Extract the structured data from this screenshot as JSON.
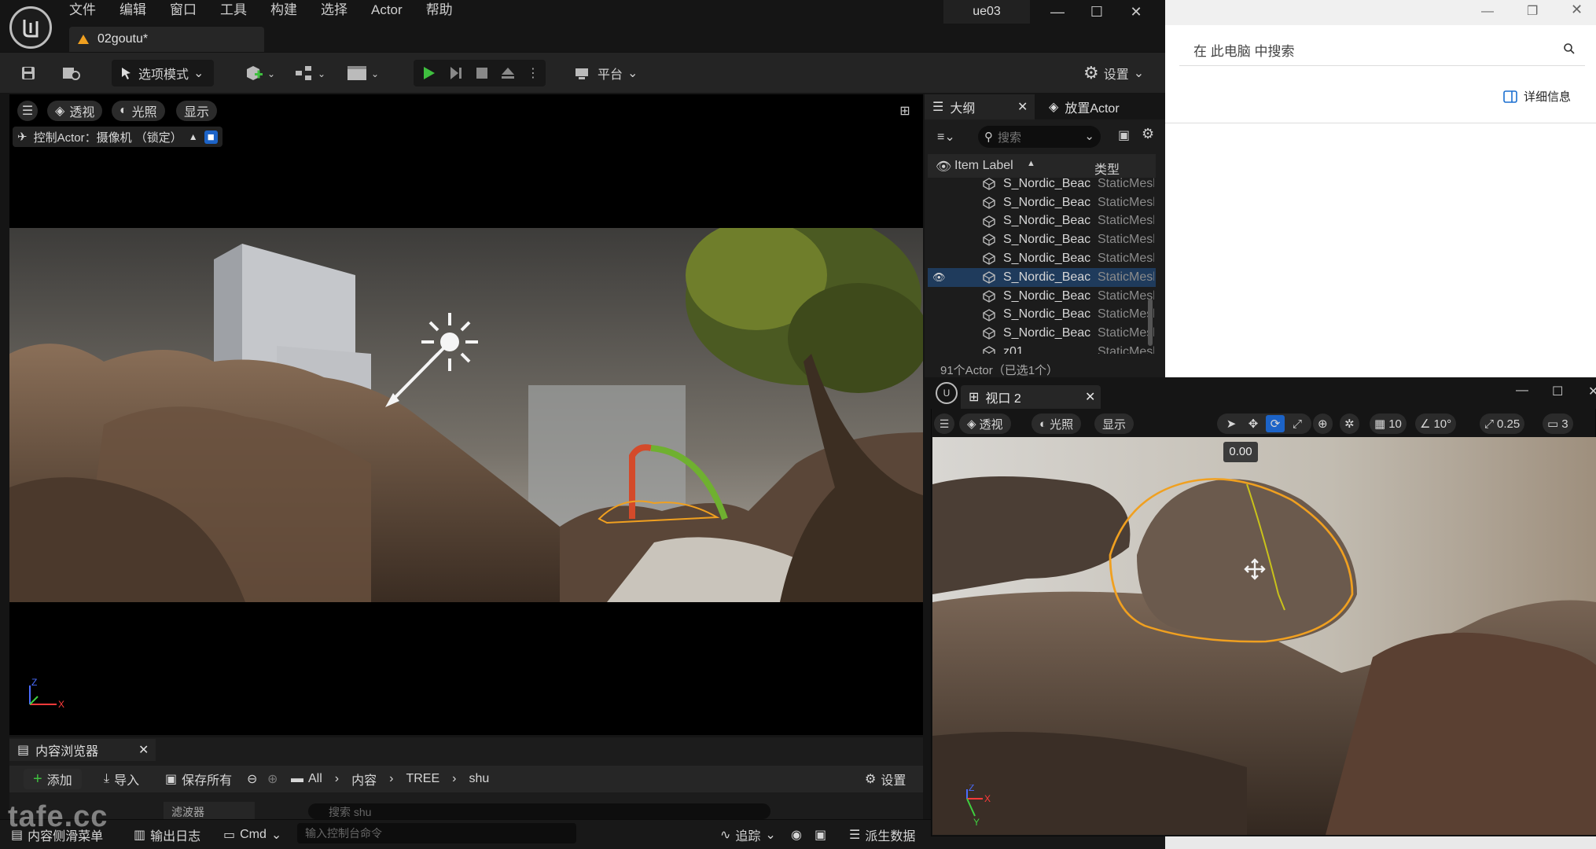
{
  "editor": {
    "menu": [
      "文件",
      "编辑",
      "窗口",
      "工具",
      "构建",
      "选择",
      "Actor",
      "帮助"
    ],
    "document_tab": "02goutu*",
    "project_name": "ue03"
  },
  "toolbar": {
    "mode_label": "选项模式",
    "platform_label": "平台",
    "settings_label": "设置"
  },
  "viewport1": {
    "perspective": "透视",
    "lighting": "光照",
    "show": "显示",
    "pilot_label": "控制Actor：摄像机 （锁定）"
  },
  "outliner": {
    "tab_outliner": "大纲",
    "tab_place": "放置Actor",
    "search_placeholder": "搜索",
    "col_label": "Item Label",
    "col_type": "类型",
    "rows": [
      {
        "label": "S_Nordic_Beach",
        "type": "StaticMesh",
        "selected": false
      },
      {
        "label": "S_Nordic_Beach",
        "type": "StaticMesh",
        "selected": false
      },
      {
        "label": "S_Nordic_Beach",
        "type": "StaticMesh",
        "selected": false
      },
      {
        "label": "S_Nordic_Beach",
        "type": "StaticMesh",
        "selected": false
      },
      {
        "label": "S_Nordic_Beach",
        "type": "StaticMesh",
        "selected": false
      },
      {
        "label": "S_Nordic_Beach",
        "type": "StaticMesh",
        "selected": true
      },
      {
        "label": "S_Nordic_Beach",
        "type": "StaticMesh",
        "selected": false
      },
      {
        "label": "S_Nordic_Beach",
        "type": "StaticMesh",
        "selected": false
      },
      {
        "label": "S_Nordic_Beach",
        "type": "StaticMesh",
        "selected": false
      },
      {
        "label": "z01",
        "type": "StaticMesh",
        "selected": false
      }
    ],
    "status": "91个Actor（已选1个）"
  },
  "content_browser": {
    "tab": "内容浏览器",
    "add": "添加",
    "import": "导入",
    "save_all": "保存所有",
    "path": [
      "All",
      "内容",
      "TREE",
      "shu"
    ],
    "settings": "设置",
    "filter": "滤波器",
    "search_placeholder": "搜索 shu"
  },
  "statusbar": {
    "drawer": "内容侧滑菜单",
    "output_log": "输出日志",
    "cmd": "Cmd",
    "cmd_placeholder": "输入控制台命令",
    "trace": "追踪",
    "derived_data": "派生数据"
  },
  "explorer": {
    "search_placeholder": "在 此电脑 中搜索",
    "details": "详细信息"
  },
  "viewport2": {
    "tab": "视口 2",
    "perspective": "透视",
    "lighting": "光照",
    "show": "显示",
    "grid_value": "10",
    "rotation_snap": "10°",
    "scale_snap": "0.25",
    "camera_speed": "3",
    "rotation_readout": "0.00"
  },
  "watermark": "tafe.cc",
  "colors": {
    "selection_blue": "#1f3b5c",
    "tool_active": "#1c63c7",
    "play_green": "#3fbf3f",
    "outline_orange": "#f0a020"
  }
}
